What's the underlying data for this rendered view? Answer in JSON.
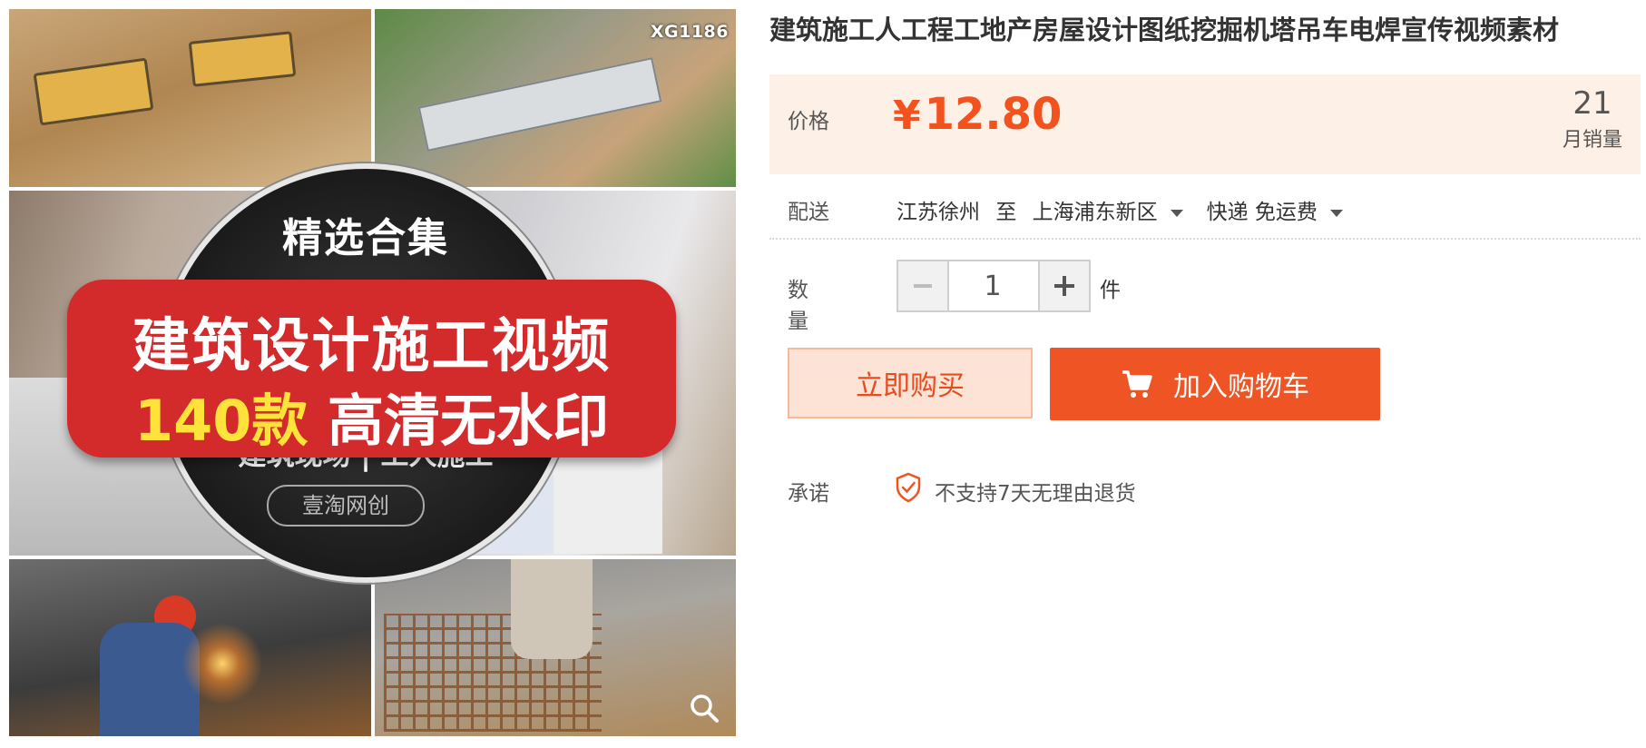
{
  "product_image": {
    "code_badge": "XG1186",
    "circle_top": "精选合集",
    "banner_line1": "建筑设计施工视频",
    "banner_count": "140款",
    "banner_line2": "高清无水印",
    "circle_bottom": "建筑现场 | 工人施工",
    "brand": "壹淘网创",
    "zoom_icon": "magnifier-icon"
  },
  "product": {
    "title": "建筑施工人工程工地产房屋设计图纸挖掘机塔吊车电焊宣传视频素材"
  },
  "price": {
    "label": "价格",
    "currency": "¥",
    "value": "12.80",
    "monthly_sales": "21",
    "monthly_sales_label": "月销量",
    "accent_color": "#f2521e",
    "bg_color": "#fdf0e6"
  },
  "shipping": {
    "label": "配送",
    "from": "江苏徐州",
    "to_word": "至",
    "destination": "上海浦东新区",
    "method": "快递 免运费"
  },
  "quantity": {
    "label": "数量",
    "value": "1",
    "unit": "件"
  },
  "actions": {
    "buy_now": "立即购买",
    "add_to_cart": "加入购物车",
    "cart_button_color": "#ee5424"
  },
  "promise": {
    "label": "承诺",
    "text": "不支持7天无理由退货",
    "icon": "shield-check-icon"
  }
}
